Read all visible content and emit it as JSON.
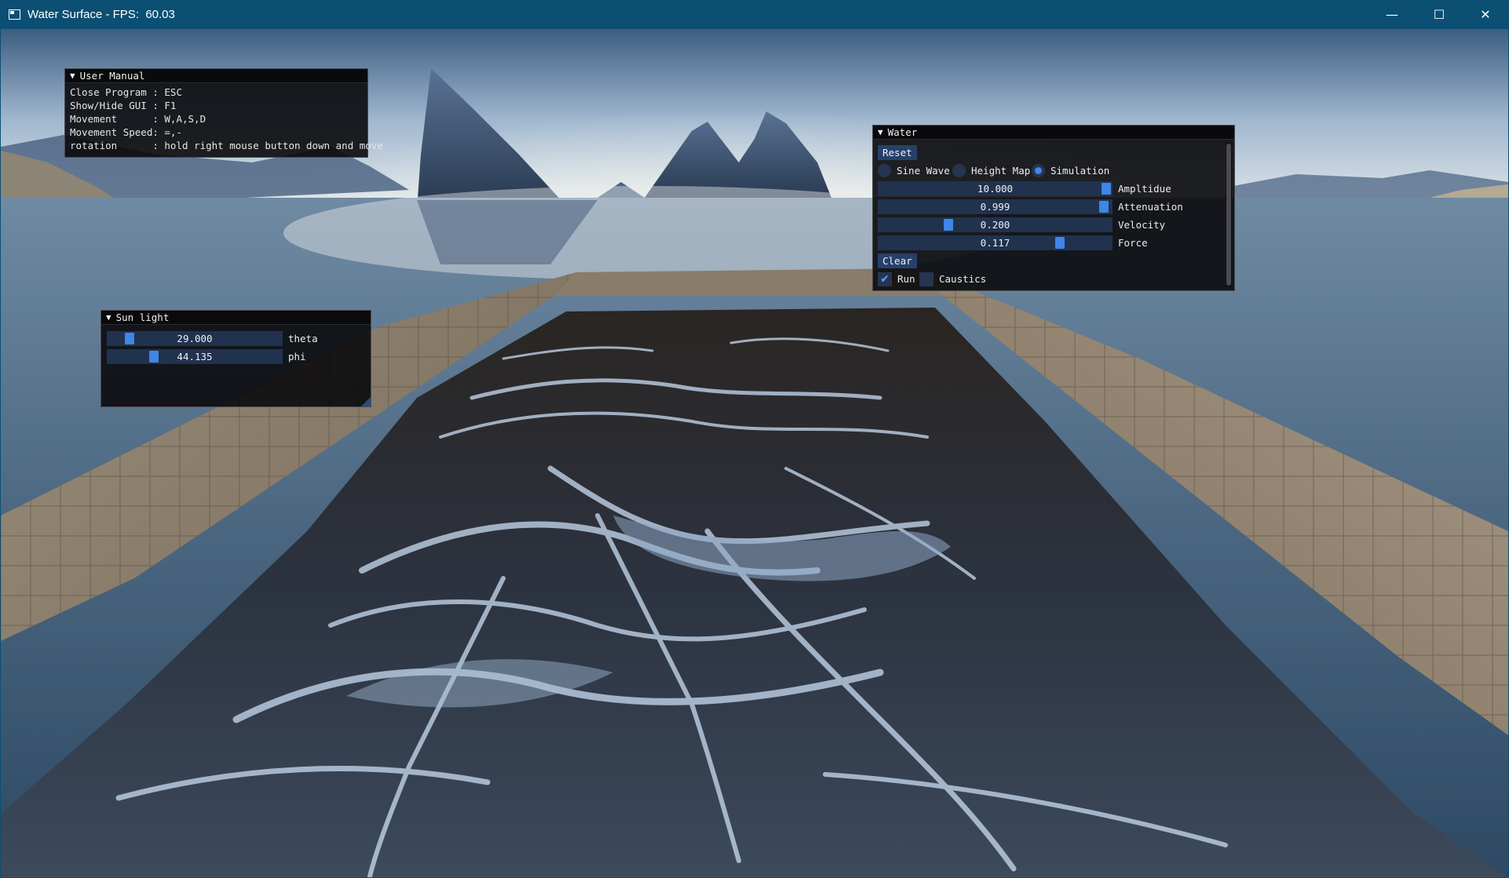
{
  "window": {
    "title": "Water Surface - FPS:  60.03",
    "min_glyph": "—",
    "max_glyph": "☐",
    "close_glyph": "✕"
  },
  "user_manual": {
    "title": "User Manual",
    "lines": [
      "Close Program : ESC",
      "Show/Hide GUI : F1",
      "Movement      : W,A,S,D",
      "Movement Speed: =,-",
      "rotation      : hold right mouse button down and move"
    ]
  },
  "sun_light": {
    "title": "Sun light",
    "sliders": [
      {
        "label": "theta",
        "value": "29.000",
        "fraction": 0.1
      },
      {
        "label": "phi",
        "value": "44.135",
        "fraction": 0.25
      }
    ]
  },
  "water": {
    "title": "Water",
    "reset_label": "Reset",
    "clear_label": "Clear",
    "modes": [
      {
        "label": "Sine Wave",
        "selected": false
      },
      {
        "label": "Height Map",
        "selected": false
      },
      {
        "label": "Simulation",
        "selected": true
      }
    ],
    "sliders": [
      {
        "label": "Ampltidue",
        "value": "10.000",
        "fraction": 1.0
      },
      {
        "label": "Attenuation",
        "value": "0.999",
        "fraction": 0.99
      },
      {
        "label": "Velocity",
        "value": "0.200",
        "fraction": 0.29
      },
      {
        "label": "Force",
        "value": "0.117",
        "fraction": 0.79
      }
    ],
    "run": {
      "label": "Run",
      "checked": true
    },
    "caustics": {
      "label": "Caustics",
      "checked": false
    }
  },
  "colors": {
    "titlebar": "#0b4f73",
    "slider_frame": "#21324f",
    "slider_grab": "#3f86e6",
    "button": "#27406a"
  }
}
